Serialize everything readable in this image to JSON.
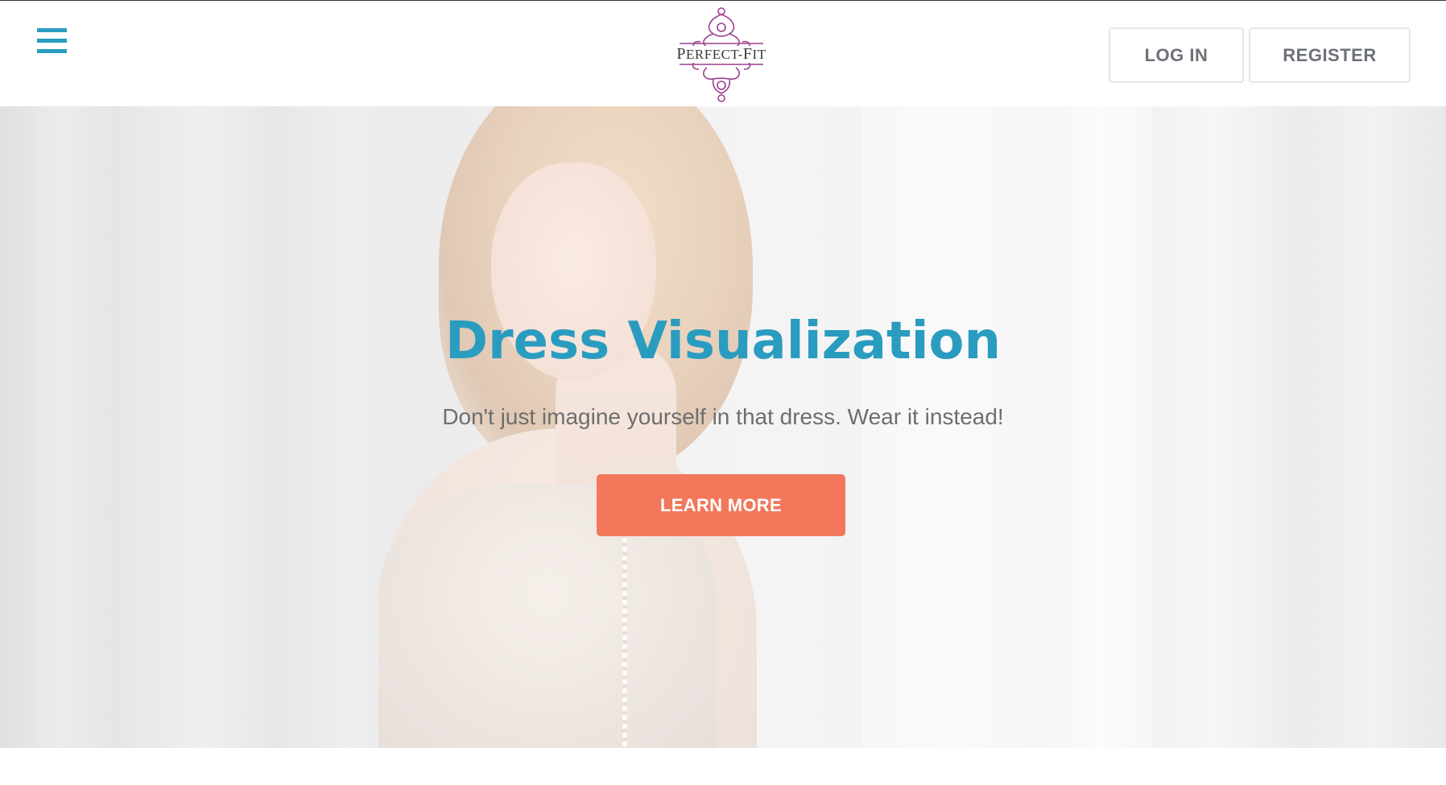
{
  "header": {
    "menu_icon": "hamburger-menu-icon",
    "logo_text_first": "P",
    "logo_text_mid": "ERFECT-",
    "logo_text_f": "F",
    "logo_text_end": "IT",
    "login_label": "LOG IN",
    "register_label": "REGISTER"
  },
  "hero": {
    "title": "Dress Visualization",
    "subtitle": "Don't just imagine yourself in that dress. Wear it instead!",
    "cta_label": "LEARN MORE"
  },
  "colors": {
    "accent_blue": "#2a9cc0",
    "cta_orange": "#f2775b",
    "logo_purple": "#9b3f8e",
    "nav_text": "#6c7078"
  }
}
